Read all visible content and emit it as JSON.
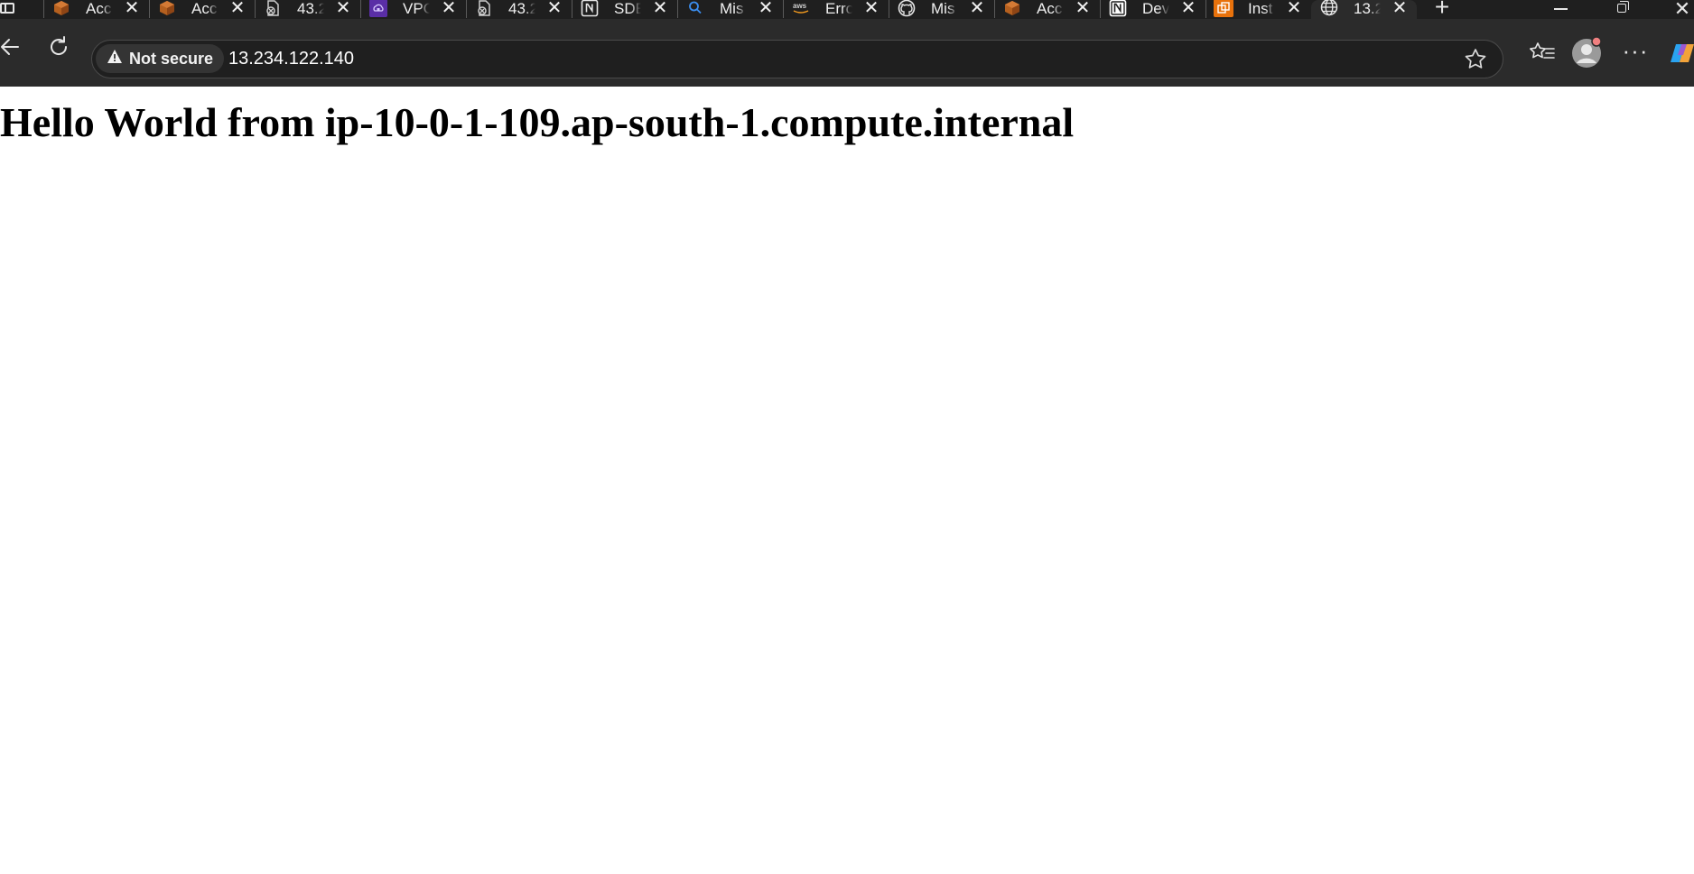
{
  "browser": {
    "tabs": [
      {
        "title": "Acc",
        "favicon": "box-icon",
        "active": false
      },
      {
        "title": "Acc",
        "favicon": "box-icon",
        "active": false
      },
      {
        "title": "43.2",
        "favicon": "blocked-page-icon",
        "active": false
      },
      {
        "title": "VPC",
        "favicon": "vpc-icon",
        "active": false
      },
      {
        "title": "43.2",
        "favicon": "blocked-page-icon",
        "active": false
      },
      {
        "title": "SDE",
        "favicon": "notion-icon",
        "active": false
      },
      {
        "title": "Mis",
        "favicon": "search-icon",
        "active": false
      },
      {
        "title": "Erro",
        "favicon": "aws-icon",
        "active": false
      },
      {
        "title": "Mis",
        "favicon": "github-icon",
        "active": false
      },
      {
        "title": "Acc",
        "favicon": "box-icon",
        "active": false
      },
      {
        "title": "Dev",
        "favicon": "notion-icon",
        "active": false
      },
      {
        "title": "Inst",
        "favicon": "instance-icon",
        "active": false
      },
      {
        "title": "13.2",
        "favicon": "globe-icon",
        "active": true
      }
    ],
    "address_bar": {
      "security_label": "Not secure",
      "url": "13.234.122.140"
    },
    "colors": {
      "tabstrip_bg": "#1f1f1f",
      "toolbar_bg": "#2b2b2b",
      "addressbar_bg": "#1f1f1f",
      "page_bg": "#ffffff",
      "profile_badge": "#f08080"
    }
  },
  "page": {
    "heading": "Hello World from ip-10-0-1-109.ap-south-1.compute.internal"
  }
}
